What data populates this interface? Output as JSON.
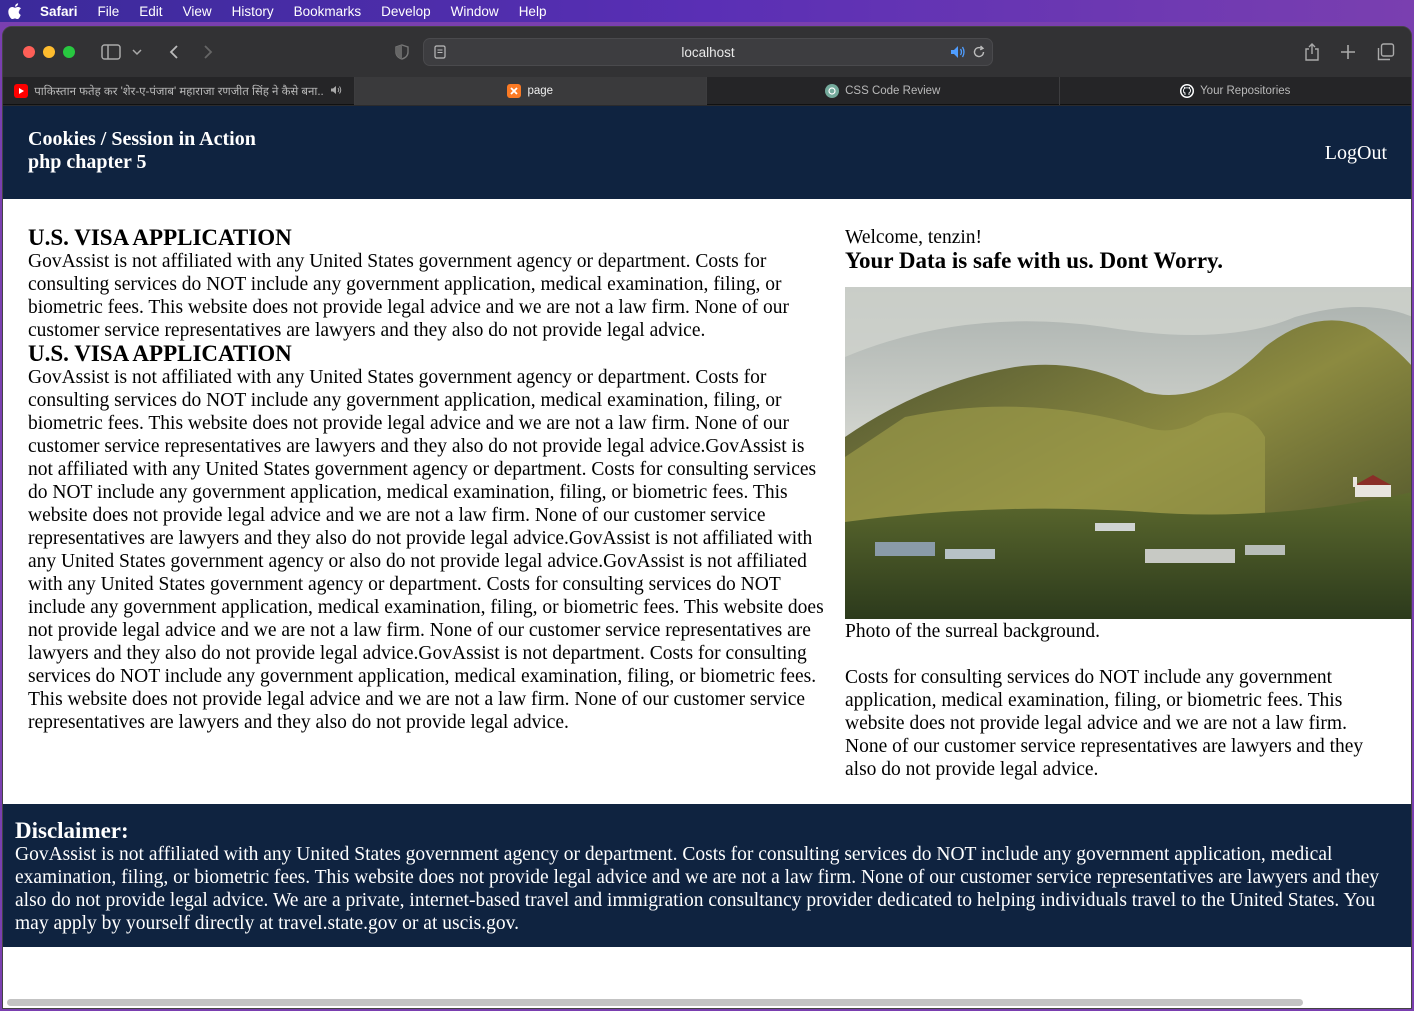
{
  "menubar": {
    "app": "Safari",
    "items": [
      "File",
      "Edit",
      "View",
      "History",
      "Bookmarks",
      "Develop",
      "Window",
      "Help"
    ]
  },
  "address": {
    "url": "localhost"
  },
  "tabs": [
    {
      "label": "पाकिस्तान फतेह कर 'शेर-ए-पंजाब' महाराजा रणजीत सिंह ने कैसे बना...",
      "icon": "youtube-icon"
    },
    {
      "label": "page",
      "icon": "xampp-icon"
    },
    {
      "label": "CSS Code Review",
      "icon": "chatgpt-icon"
    },
    {
      "label": "Your Repositories",
      "icon": "github-icon"
    }
  ],
  "site": {
    "brand_line1": "Cookies / Session in Action",
    "brand_line2": "php chapter 5",
    "logout": "LogOut"
  },
  "left": {
    "heading1": "U.S. VISA APPLICATION",
    "para1": "GovAssist is not affiliated with any United States government agency or department. Costs for consulting services do NOT include any government application, medical examination, filing, or biometric fees. This website does not provide legal advice and we are not a law firm. None of our customer service representatives are lawyers and they also do not provide legal advice.",
    "heading2": "U.S. VISA APPLICATION",
    "para2": "GovAssist is not affiliated with any United States government agency or department. Costs for consulting services do NOT include any government application, medical examination, filing, or biometric fees. This website does not provide legal advice and we are not a law firm. None of our customer service representatives are lawyers and they also do not provide legal advice.GovAssist is not affiliated with any United States government agency or department. Costs for consulting services do NOT include any government application, medical examination, filing, or biometric fees. This website does not provide legal advice and we are not a law firm. None of our customer service representatives are lawyers and they also do not provide legal advice.GovAssist is not affiliated with any United States government agency or also do not provide legal advice.GovAssist is not affiliated with any United States government agency or department. Costs for consulting services do NOT include any government application, medical examination, filing, or biometric fees. This website does not provide legal advice and we are not a law firm. None of our customer service representatives are lawyers and they also do not provide legal advice.GovAssist is not department. Costs for consulting services do NOT include any government application, medical examination, filing, or biometric fees. This website does not provide legal advice and we are not a law firm. None of our customer service representatives are lawyers and they also do not provide legal advice."
  },
  "right": {
    "welcome": "Welcome, tenzin!",
    "safe": "Your Data is safe with us. Dont Worry.",
    "caption": "Photo of the surreal background.",
    "para": "Costs for consulting services do NOT include any government application, medical examination, filing, or biometric fees. This website does not provide legal advice and we are not a law firm. None of our customer service representatives are lawyers and they also do not provide legal advice."
  },
  "footer": {
    "title": "Disclaimer:",
    "text": "GovAssist is not affiliated with any United States government agency or department. Costs for consulting services do NOT include any government application, medical examination, filing, or biometric fees. This website does not provide legal advice and we are not a law firm. None of our customer service representatives are lawyers and they also do not provide legal advice. We are a private, internet-based travel and immigration consultancy provider dedicated to helping individuals travel to the United States. You may apply by yourself directly at travel.state.gov or at uscis.gov."
  },
  "colors": {
    "header_bg": "#0f2340",
    "footer_bg": "#0f2340",
    "menubar_gradient_start": "#3a2a9a",
    "menubar_gradient_end": "#7a3fb0"
  }
}
